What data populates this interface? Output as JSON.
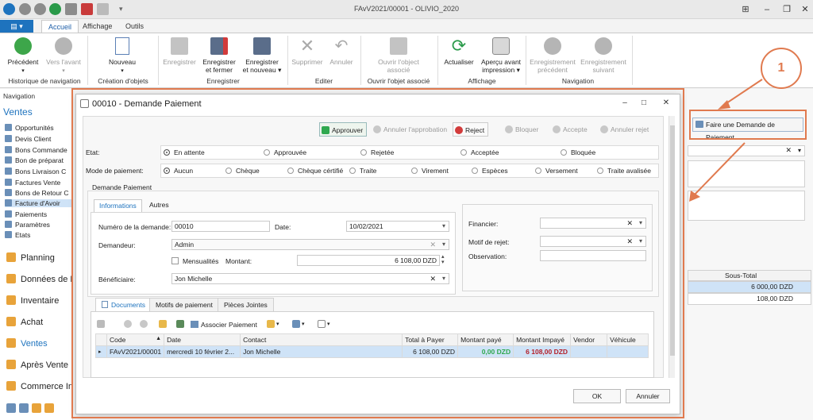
{
  "app": {
    "title": "FAvV2021/00001 - OLIVIO_2020"
  },
  "ribbon": {
    "tabs": [
      "Accueil",
      "Affichage",
      "Outils"
    ],
    "file_label": "▤ ▾",
    "buttons": {
      "precedent": "Précédent",
      "vers_avant": "Vers l'avant",
      "nouveau": "Nouveau",
      "enregistrer": "Enregistrer",
      "enregistrer_fermer_1": "Enregistrer",
      "enregistrer_fermer_2": "et fermer",
      "enregistrer_nouveau_1": "Enregistrer",
      "enregistrer_nouveau_2": "et nouveau",
      "supprimer": "Supprimer",
      "annuler": "Annuler",
      "ouvrir_1": "Ouvrir l'object",
      "ouvrir_2": "associé",
      "actualiser": "Actualiser",
      "apercu_1": "Aperçu avant",
      "apercu_2": "impression",
      "enr_prec_1": "Enregistrement",
      "enr_prec_2": "précédent",
      "enr_suiv_1": "Enregistrement",
      "enr_suiv_2": "suivant"
    },
    "groups": [
      "Historique de navigation",
      "Création d'objets",
      "Enregistrer",
      "Editer",
      "Ouvrir l'objet associé",
      "Affichage",
      "Navigation"
    ]
  },
  "nav": {
    "header": "Navigation",
    "section": "Ventes",
    "items": [
      "Opportunités",
      "Devis Client",
      "Bons Commande",
      "Bon de préparat",
      "Bons Livraison C",
      "Factures Vente",
      "Bons de Retour C",
      "Facture d'Avoir",
      "Paiements",
      "Paramètres",
      "Etats"
    ],
    "modules": [
      "Planning",
      "Données de B",
      "Inventaire",
      "Achat",
      "Ventes",
      "Après Vente",
      "Commerce In"
    ]
  },
  "right": {
    "demand_button": "Faire une Demande de Paiement",
    "col_header": "Sous-Total",
    "values": [
      "6 000,00 DZD",
      "108,00 DZD"
    ]
  },
  "annotation": {
    "number": "1"
  },
  "dialog": {
    "title": "00010 - Demande Paiement",
    "toolbar": [
      "Approuver",
      "Annuler l'approbation",
      "Reject",
      "Bloquer",
      "Accepte",
      "Annuler rejet"
    ],
    "etat_label": "Etat:",
    "etat_options": [
      "En attente",
      "Approuvée",
      "Rejetée",
      "Acceptée",
      "Bloquée"
    ],
    "mode_label": "Mode de paiement:",
    "mode_options": [
      "Aucun",
      "Chèque",
      "Chèque cértifié",
      "Traite",
      "Virement",
      "Espèces",
      "Versement",
      "Traite avalisée"
    ],
    "section_title": "Demande Paiement",
    "tabs": [
      "Informations",
      "Autres"
    ],
    "fields": {
      "numero_label": "Numéro de la demande:",
      "numero_value": "00010",
      "date_label": "Date:",
      "date_value": "10/02/2021",
      "demandeur_label": "Demandeur:",
      "demandeur_value": "Admin",
      "mensualites_label": "Mensualités",
      "montant_label": "Montant:",
      "montant_value": "6 108,00 DZD",
      "beneficiaire_label": "Bénéficiaire:",
      "beneficiaire_value": "Jon Michelle",
      "financier_label": "Financier:",
      "motif_label": "Motif de rejet:",
      "observation_label": "Observation:"
    },
    "bottom_tabs": [
      "Documents",
      "Motifs de paiement",
      "Pièces Jointes"
    ],
    "grid_toolbar_label": "Associer Paiement",
    "grid": {
      "columns": [
        "Code",
        "Date",
        "Contact",
        "Total à Payer",
        "Montant payé",
        "Montant Impayé",
        "Vendor",
        "Véhicule"
      ],
      "rows": [
        [
          "FAvV2021/00001",
          "mercredi 10 février 2...",
          "Jon Michelle",
          "6 108,00 DZD",
          "0,00 DZD",
          "6 108,00 DZD",
          "",
          ""
        ]
      ]
    },
    "ok": "OK",
    "cancel": "Annuler"
  },
  "colors": {
    "accent": "#1e73be",
    "annotation": "#e07a4f",
    "paid": "#2fa84f",
    "unpaid": "#b3202a"
  }
}
